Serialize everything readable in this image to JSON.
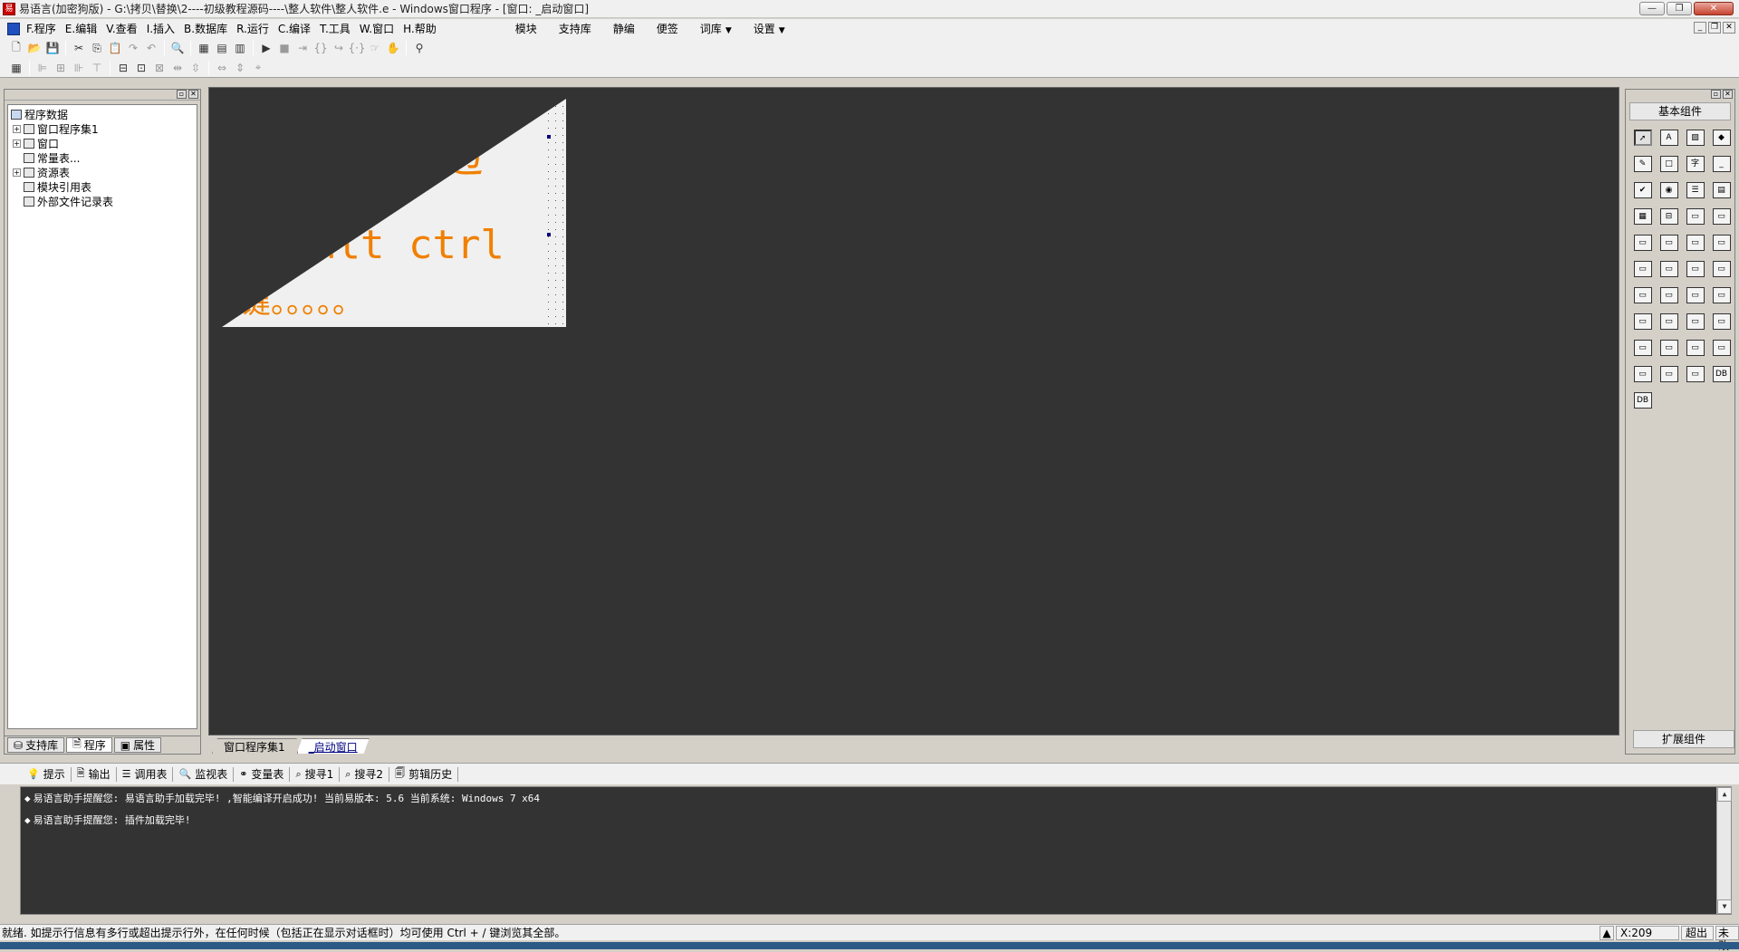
{
  "window": {
    "title": "易语言(加密狗版) - G:\\拷贝\\替换\\2----初级教程源码----\\整人软件\\整人软件.e - Windows窗口程序 - [窗口: _启动窗口]",
    "icon": "app-icon",
    "controls": {
      "minimize": "—",
      "restore": "❐",
      "close": "✕"
    }
  },
  "menubar": {
    "items": [
      "F.程序",
      "E.编辑",
      "V.查看",
      "I.插入",
      "B.数据库",
      "R.运行",
      "C.编译",
      "T.工具",
      "W.窗口",
      "H.帮助"
    ],
    "plugins": [
      "模块",
      "支持库",
      "静编",
      "便签",
      "词库",
      "设置"
    ],
    "mdi": {
      "minimize": "_",
      "restore": "❐",
      "close": "✕"
    }
  },
  "toolbar1": [
    "new-file-icon",
    "open-icon",
    "save-icon",
    "cut-icon",
    "copy-icon",
    "paste-icon",
    "redo-icon",
    "undo-icon",
    "find-icon",
    "layout1-icon",
    "layout2-icon",
    "layout3-icon",
    "run-icon",
    "stop-icon",
    "step-icon",
    "step-into-icon",
    "step-out-icon",
    "breakpoint-icon",
    "pointer-icon",
    "hand-icon",
    "binoculars-icon"
  ],
  "toolbar2": [
    "grid-icon",
    "align-left-icon",
    "align-center-icon",
    "align-right-icon",
    "align-top-icon",
    "align-middle-icon",
    "align-bottom-icon",
    "same-width-icon",
    "same-height-icon",
    "same-size-icon",
    "h-space-icon",
    "v-space-icon",
    "center-h-icon",
    "center-v-icon",
    "center-both-icon"
  ],
  "leftpanel": {
    "tree": [
      {
        "label": "程序数据",
        "level": 0,
        "expand": false,
        "icon": "database-icon"
      },
      {
        "label": "窗口程序集1",
        "level": 1,
        "expand": true,
        "icon": "module-icon"
      },
      {
        "label": "窗口",
        "level": 1,
        "expand": true,
        "icon": "window-icon"
      },
      {
        "label": "常量表...",
        "level": 1,
        "expand": false,
        "icon": "constants-icon"
      },
      {
        "label": "资源表",
        "level": 1,
        "expand": true,
        "icon": "resources-icon"
      },
      {
        "label": "模块引用表",
        "level": 1,
        "expand": false,
        "icon": "module-ref-icon"
      },
      {
        "label": "外部文件记录表",
        "level": 1,
        "expand": false,
        "icon": "external-file-icon"
      }
    ],
    "tabs": [
      "支持库",
      "程序",
      "属性"
    ]
  },
  "form": {
    "line1": "半边",
    "line2": "alt ctrl",
    "line3": "键。。。。。"
  },
  "doctabs": [
    "窗口程序集1",
    "_启动窗口"
  ],
  "rightpanel": {
    "title": "基本组件",
    "footer": "扩展组件",
    "components": [
      "pointer",
      "label",
      "picture",
      "shape",
      "edit",
      "frame",
      "text",
      "line",
      "checkbox",
      "radio",
      "listbox",
      "combobox",
      "table",
      "tabs",
      "scrollbar-v",
      "scrollbar-h",
      "progress",
      "slider",
      "vscroll",
      "tabctrl",
      "calendar",
      "edit2",
      "chart",
      "doc",
      "timer-grid",
      "printer",
      "ruler",
      "grid2",
      "timer",
      "printer2",
      "server",
      "client",
      "port",
      "net",
      "panel",
      "datagrid",
      "dbconn",
      "db",
      "graph",
      "odbc",
      "odbc2"
    ]
  },
  "output": {
    "tabs": [
      "提示",
      "输出",
      "调用表",
      "监视表",
      "变量表",
      "搜寻1",
      "搜寻2",
      "剪辑历史"
    ],
    "lines": [
      "易语言助手提醒您: 易语言助手加载完毕! ,智能编译开启成功! 当前易版本: 5.6 当前系统: Windows 7 x64",
      "易语言助手提醒您: 插件加载完毕!"
    ]
  },
  "statusbar": {
    "text": "就绪. 如提示行信息有多行或超出提示行外，在任何时候（包括正在显示对话框时）均可使用 Ctrl + / 键浏览其全部。",
    "coord": "X:209",
    "mode": "超出",
    "state": "未改"
  },
  "colors": {
    "canvas": "#333333",
    "form_text": "#f08000",
    "form_bg": "#f0f0f0"
  }
}
